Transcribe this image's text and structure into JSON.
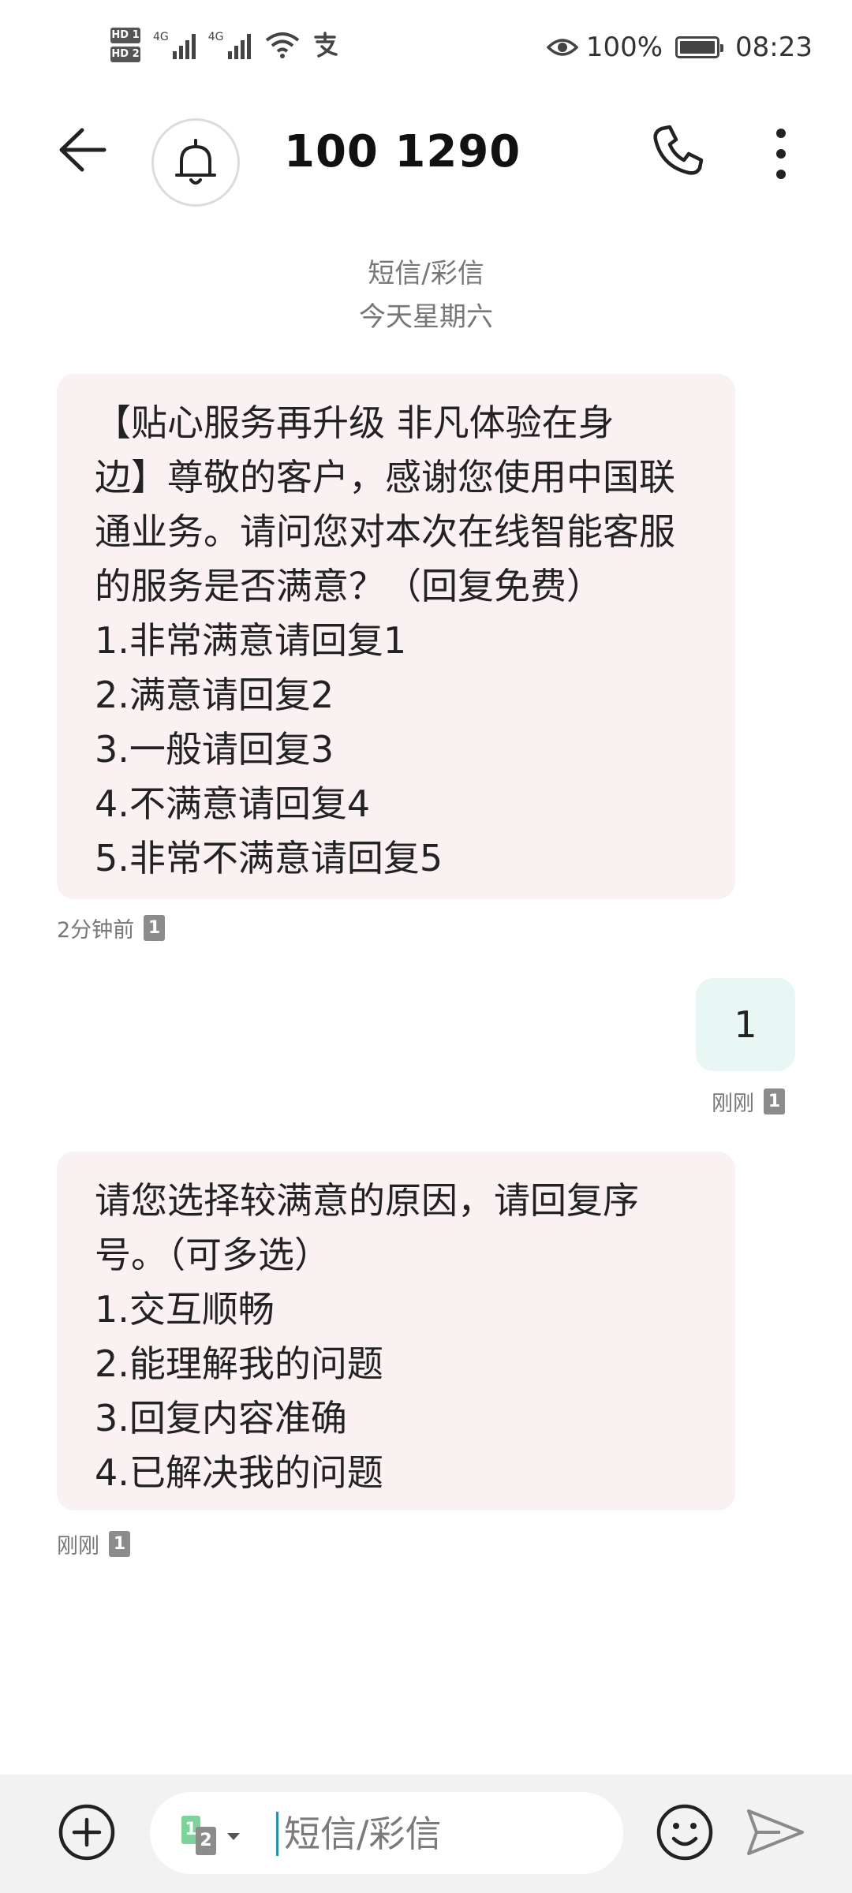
{
  "status_bar": {
    "hd1": "HD 1",
    "hd2": "HD 2",
    "net1": "4G",
    "net2": "4G",
    "battery_pct": "100%",
    "time": "08:23"
  },
  "header": {
    "contact": "100 1290"
  },
  "thread": {
    "type_label": "短信/彩信",
    "date_label": "今天星期六",
    "messages": [
      {
        "direction": "incoming",
        "text": "【贴心服务再升级 非凡体验在身\n边】尊敬的客户，感谢您使用中国联\n通业务。请问您对本次在线智能客服\n的服务是否满意？（回复免费）\n1.非常满意请回复1\n2.满意请回复2\n3.一般请回复3\n4.不满意请回复4\n5.非常不满意请回复5",
        "time": "2分钟前",
        "sim": "1"
      },
      {
        "direction": "outgoing",
        "text": "1",
        "time": "刚刚",
        "sim": "1"
      },
      {
        "direction": "incoming",
        "text": "请您选择较满意的原因，请回复序\n号。（可多选）\n1.交互顺畅\n2.能理解我的问题\n3.回复内容准确\n4.已解决我的问题",
        "time": "刚刚",
        "sim": "1"
      }
    ]
  },
  "composer": {
    "placeholder": "短信/彩信",
    "sim_primary": "1",
    "sim_secondary": "2"
  },
  "icons": {
    "back": "arrow-left-icon",
    "avatar": "bell-icon",
    "call": "phone-icon",
    "more": "more-vertical-icon",
    "add": "plus-circle-icon",
    "emoji": "smiley-icon",
    "send": "send-icon",
    "eye": "eye-icon",
    "wifi": "wifi-icon",
    "alipay": "alipay-icon"
  }
}
